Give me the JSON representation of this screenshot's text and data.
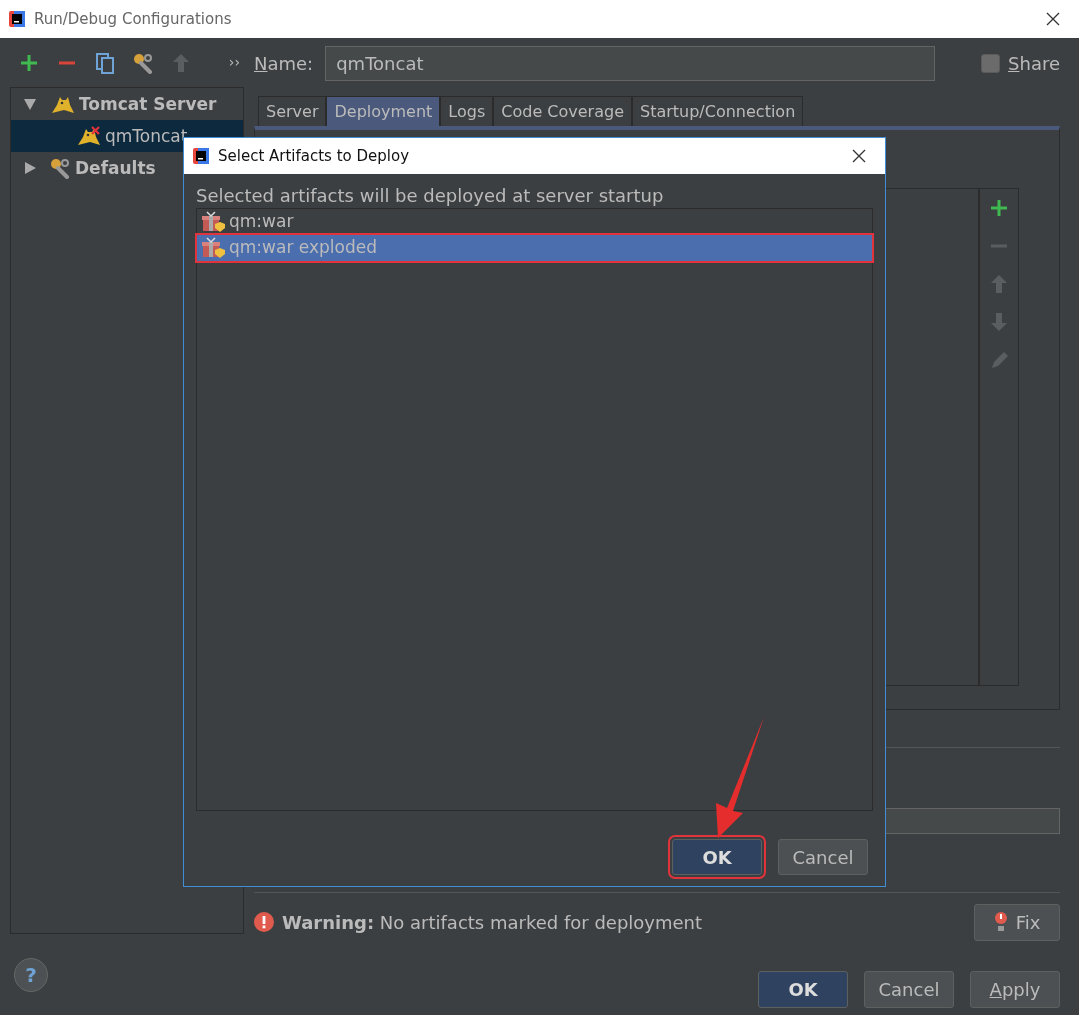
{
  "window": {
    "title": "Run/Debug Configurations"
  },
  "toolbar": [
    {
      "kind": "add",
      "disabled": false
    },
    {
      "kind": "remove",
      "disabled": false
    },
    {
      "kind": "copy",
      "disabled": false
    },
    {
      "kind": "wrench",
      "disabled": false
    },
    {
      "kind": "up",
      "disabled": true
    }
  ],
  "toolbar_more": "››",
  "tree": [
    {
      "label": "Tomcat Server",
      "kind": "tomcat",
      "expanded": true,
      "selected": false,
      "children": [
        {
          "label": "qmToncat",
          "kind": "tomcat-error",
          "selected": true
        }
      ]
    },
    {
      "label": "Defaults",
      "kind": "wrench",
      "expanded": false,
      "selected": false
    }
  ],
  "name_field": {
    "label": "Name:",
    "mnemonic": true,
    "value": "qmToncat"
  },
  "share": {
    "label": "Share",
    "mnemonic": true,
    "checked": false
  },
  "tabs": [
    {
      "label": "Server",
      "selected": false
    },
    {
      "label": "Deployment",
      "selected": true
    },
    {
      "label": "Logs",
      "selected": false
    },
    {
      "label": "Code Coverage",
      "selected": false
    },
    {
      "label": "Startup/Connection",
      "selected": false
    }
  ],
  "side_toolbar": [
    {
      "kind": "add",
      "disabled": false
    },
    {
      "kind": "remove",
      "disabled": true
    },
    {
      "kind": "up",
      "disabled": true
    },
    {
      "kind": "down",
      "disabled": true
    },
    {
      "kind": "edit",
      "disabled": true
    }
  ],
  "warning": "**Warning:** No artifacts marked for deployment",
  "fix_button": "Fix",
  "buttons": [
    {
      "label": "OK",
      "default": true,
      "mnemonic": false
    },
    {
      "label": "Cancel",
      "default": false,
      "mnemonic": false
    },
    {
      "label": "Apply",
      "default": false,
      "mnemonic": true
    }
  ],
  "dialog": {
    "title": "Select Artifacts to Deploy",
    "hint": "Selected artifacts will be deployed at server startup",
    "artifacts": [
      {
        "label": "qm:war",
        "selected": false,
        "highlighted": false
      },
      {
        "label": "qm:war exploded",
        "selected": true,
        "highlighted": true
      }
    ],
    "buttons": [
      {
        "label": "OK",
        "default": true,
        "highlighted": true
      },
      {
        "label": "Cancel",
        "default": false,
        "highlighted": false
      }
    ]
  },
  "help_button": "?",
  "annotation_arrow": true
}
